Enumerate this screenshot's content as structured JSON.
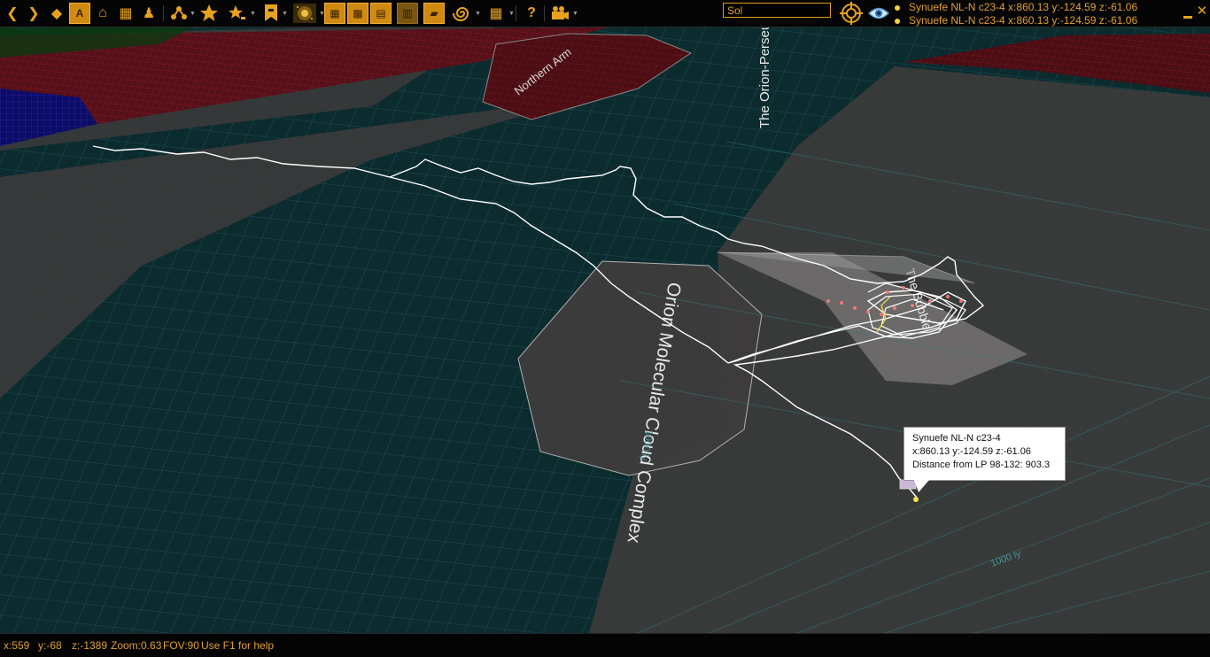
{
  "toolbar": {
    "buttons": [
      {
        "name": "back-button",
        "glyph": "❮"
      },
      {
        "name": "forward-button",
        "glyph": "❯"
      },
      {
        "name": "gem-button",
        "glyph": "◆"
      },
      {
        "name": "route-button",
        "glyph": "A"
      },
      {
        "name": "home-button",
        "glyph": "⌂"
      },
      {
        "name": "grid-button",
        "glyph": "▦"
      },
      {
        "name": "commander-button",
        "glyph": "♟"
      }
    ]
  },
  "search": {
    "value": "Sol"
  },
  "system_info": [
    "Synuefe NL-N c23-4 x:860.13 y:-124.59 z:-61.06",
    "Synuefe NL-N c23-4 x:860.13 y:-124.59 z:-61.06"
  ],
  "map": {
    "region_labels": {
      "orion": "Orion Molecular Cloud Complex",
      "gap": "The Orion-Perseus Gap",
      "northern": "Northern Arm",
      "bubble": "The Bubble"
    },
    "scale_labels": {
      "mid": "1000 ly",
      "right": "1000 ly"
    }
  },
  "tooltip": {
    "name": "Synuefe NL-N c23-4",
    "coords": "x:860.13 y:-124.59 z:-61.06",
    "distance": "Distance from LP 98-132: 903.3"
  },
  "status": {
    "x": "x:559",
    "y": "y:-68",
    "z": "z:-1389",
    "zoom": "Zoom:0.63",
    "fov": "FOV:90",
    "help": "Use F1 for help"
  },
  "colors": {
    "accent": "#e0a030",
    "teal_region": "#0c2b2f",
    "grey_region": "#3a3a3a",
    "red_region": "#5a0e14",
    "blue_region": "#0a0a5a",
    "grid_line": "#2f7f86"
  }
}
